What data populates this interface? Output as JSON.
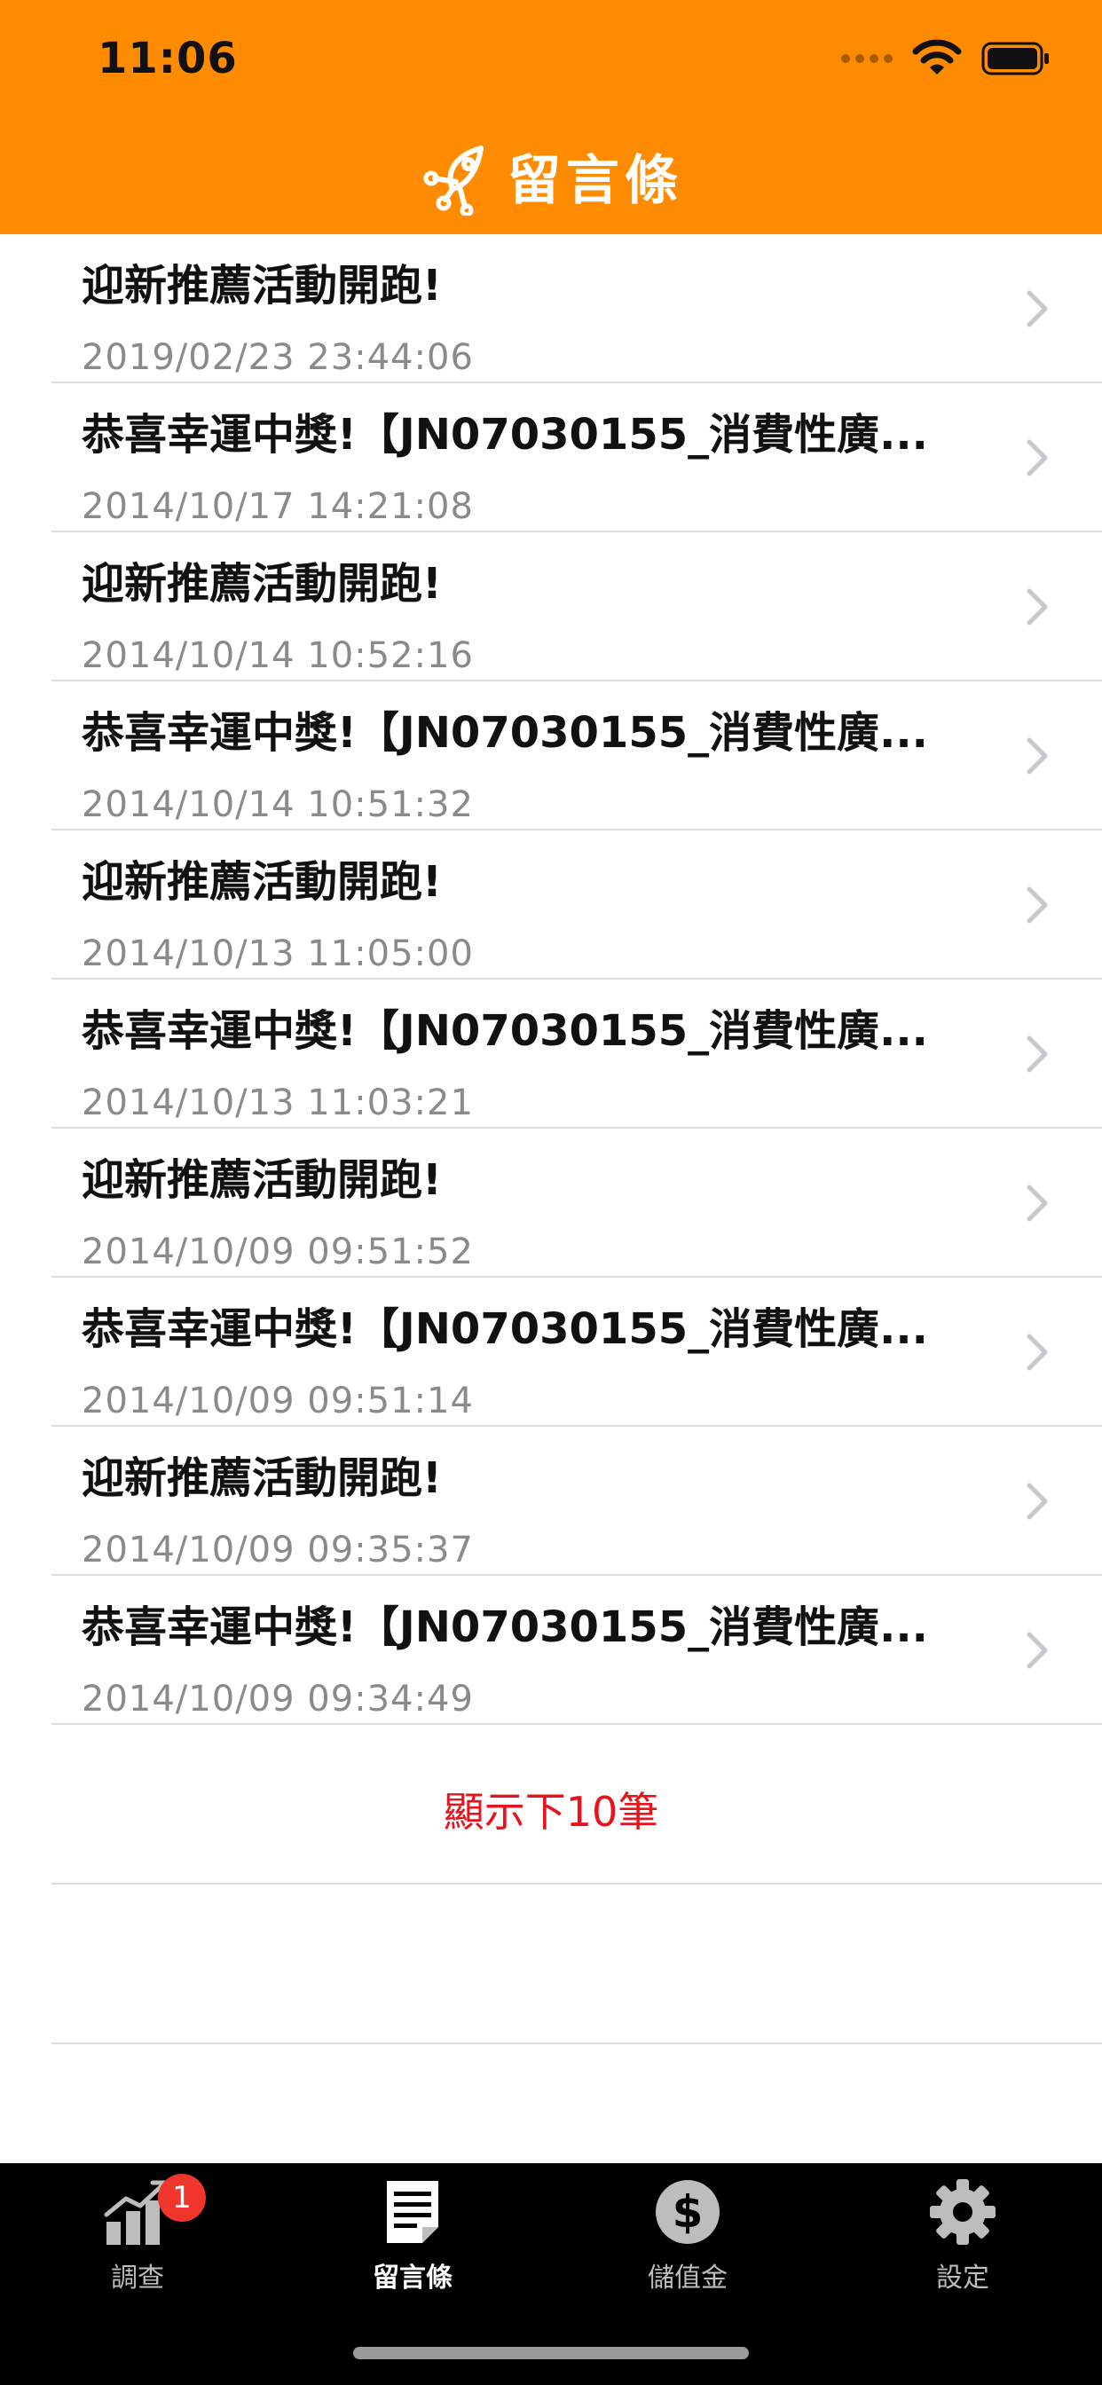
{
  "status_bar": {
    "time": "11:06"
  },
  "header": {
    "title": "留言條"
  },
  "messages": [
    {
      "title": "迎新推薦活動開跑!",
      "time": "2019/02/23 23:44:06"
    },
    {
      "title": "恭喜幸運中獎!【JN07030155_消費性廣...",
      "time": "2014/10/17 14:21:08"
    },
    {
      "title": "迎新推薦活動開跑!",
      "time": "2014/10/14 10:52:16"
    },
    {
      "title": "恭喜幸運中獎!【JN07030155_消費性廣...",
      "time": "2014/10/14 10:51:32"
    },
    {
      "title": "迎新推薦活動開跑!",
      "time": "2014/10/13 11:05:00"
    },
    {
      "title": "恭喜幸運中獎!【JN07030155_消費性廣...",
      "time": "2014/10/13 11:03:21"
    },
    {
      "title": "迎新推薦活動開跑!",
      "time": "2014/10/09 09:51:52"
    },
    {
      "title": "恭喜幸運中獎!【JN07030155_消費性廣...",
      "time": "2014/10/09 09:51:14"
    },
    {
      "title": "迎新推薦活動開跑!",
      "time": "2014/10/09 09:35:37"
    },
    {
      "title": "恭喜幸運中獎!【JN07030155_消費性廣...",
      "time": "2014/10/09 09:34:49"
    }
  ],
  "load_more": {
    "label": "顯示下10筆"
  },
  "tabbar": {
    "tabs": [
      {
        "label": "調查",
        "icon": "chart-icon",
        "badge": "1"
      },
      {
        "label": "留言條",
        "icon": "note-icon"
      },
      {
        "label": "儲值金",
        "icon": "dollar-icon"
      },
      {
        "label": "設定",
        "icon": "gear-icon"
      }
    ],
    "active_index": 1
  },
  "colors": {
    "header": "#FF8C00",
    "accent_red": "#e8131c",
    "tabbar": "#000000"
  }
}
